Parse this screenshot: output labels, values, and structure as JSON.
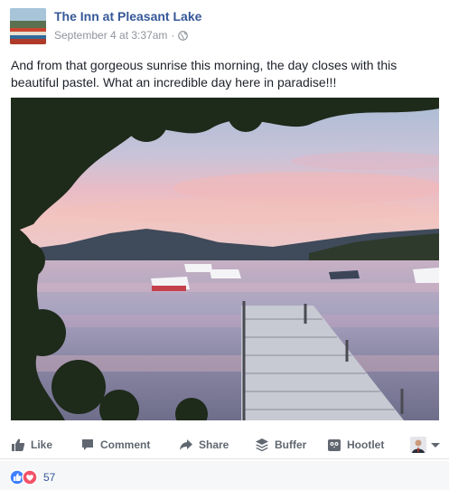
{
  "post": {
    "page_name": "The Inn at Pleasant Lake",
    "timestamp": "September 4 at 3:37am",
    "separator": "·",
    "privacy_icon": "globe-icon",
    "text": "And from that gorgeous sunrise this morning, the day closes with this beautiful pastel. What an incredible day here in paradise!!!"
  },
  "actions": {
    "like": "Like",
    "comment": "Comment",
    "share": "Share",
    "buffer": "Buffer",
    "hootlet": "Hootlet"
  },
  "reactions": {
    "count": "57",
    "types": [
      "like",
      "love"
    ]
  },
  "colors": {
    "link_blue": "#365899",
    "text": "#1d2129",
    "muted": "#90949c",
    "action_gray": "#606770",
    "like_blue": "#4080ff",
    "love_red": "#f25268"
  }
}
